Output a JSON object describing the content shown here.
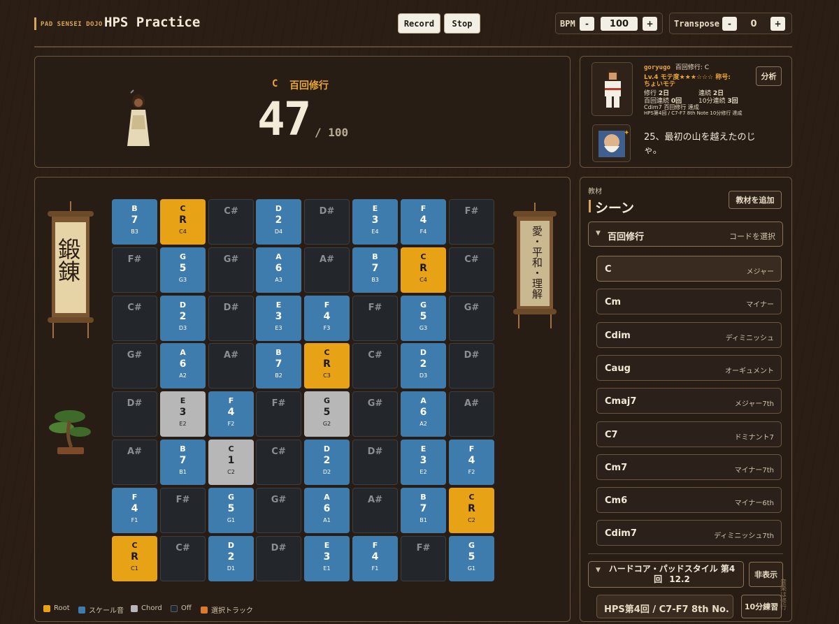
{
  "header": {
    "brand_small": "PAD SENSEI DOJO",
    "title": "HPS Practice",
    "record_label": "Record",
    "stop_label": "Stop",
    "bpm_label": "BPM",
    "bpm_minus": "-",
    "bpm_value": "100",
    "bpm_plus": "+",
    "transpose_label": "Transpose",
    "transpose_minus": "-",
    "transpose_value": "0",
    "transpose_plus": "+"
  },
  "status": {
    "chord": "C",
    "mode": "百回修行",
    "count": "47",
    "total": "/ 100"
  },
  "profile": {
    "username": "goryugo",
    "mode_text": "百回修行: C",
    "level_text": "Lv.4 モテ度★★★☆☆☆ 称号:",
    "title_text": "ちょいモテ",
    "stat_days_label": "修行",
    "stat_days_value": "2日",
    "stat_streak_label": "連続",
    "stat_streak_value": "2日",
    "stat_consec_label": "百回連続",
    "stat_consec_value": "0回",
    "stat_tenmin_label": "10分連続",
    "stat_tenmin_value": "3回",
    "line_cdim": "Cdim7 百回修行 達成",
    "line_hps": "HPS第4回 / C7-F7 8th Note 10分修行 達成",
    "analyze_label": "分析",
    "sensei_message": "25、最初の山を越えたのじゃ。"
  },
  "scrolls": {
    "left_text": "鍛錬",
    "right_text": "愛・平和・理解"
  },
  "pads": {
    "rows": [
      [
        [
          "B",
          "7",
          "B3",
          "scale"
        ],
        [
          "C",
          "R",
          "C4",
          "root"
        ],
        [
          "C#",
          "",
          "",
          "off"
        ],
        [
          "D",
          "2",
          "D4",
          "scale"
        ],
        [
          "D#",
          "",
          "",
          "off"
        ],
        [
          "E",
          "3",
          "E4",
          "scale"
        ],
        [
          "F",
          "4",
          "F4",
          "scale"
        ],
        [
          "F#",
          "",
          "",
          "off"
        ]
      ],
      [
        [
          "F#",
          "",
          "",
          "off"
        ],
        [
          "G",
          "5",
          "G3",
          "scale"
        ],
        [
          "G#",
          "",
          "",
          "off"
        ],
        [
          "A",
          "6",
          "A3",
          "scale"
        ],
        [
          "A#",
          "",
          "",
          "off"
        ],
        [
          "B",
          "7",
          "B3",
          "scale"
        ],
        [
          "C",
          "R",
          "C4",
          "root"
        ],
        [
          "C#",
          "",
          "",
          "off"
        ]
      ],
      [
        [
          "C#",
          "",
          "",
          "off"
        ],
        [
          "D",
          "2",
          "D3",
          "scale"
        ],
        [
          "D#",
          "",
          "",
          "off"
        ],
        [
          "E",
          "3",
          "E3",
          "scale"
        ],
        [
          "F",
          "4",
          "F3",
          "scale"
        ],
        [
          "F#",
          "",
          "",
          "off"
        ],
        [
          "G",
          "5",
          "G3",
          "scale"
        ],
        [
          "G#",
          "",
          "",
          "off"
        ]
      ],
      [
        [
          "G#",
          "",
          "",
          "off"
        ],
        [
          "A",
          "6",
          "A2",
          "scale"
        ],
        [
          "A#",
          "",
          "",
          "off"
        ],
        [
          "B",
          "7",
          "B2",
          "scale"
        ],
        [
          "C",
          "R",
          "C3",
          "root"
        ],
        [
          "C#",
          "",
          "",
          "off"
        ],
        [
          "D",
          "2",
          "D3",
          "scale"
        ],
        [
          "D#",
          "",
          "",
          "off"
        ]
      ],
      [
        [
          "D#",
          "",
          "",
          "off"
        ],
        [
          "E",
          "3",
          "E2",
          "chord"
        ],
        [
          "F",
          "4",
          "F2",
          "scale"
        ],
        [
          "F#",
          "",
          "",
          "off"
        ],
        [
          "G",
          "5",
          "G2",
          "chord"
        ],
        [
          "G#",
          "",
          "",
          "off"
        ],
        [
          "A",
          "6",
          "A2",
          "scale"
        ],
        [
          "A#",
          "",
          "",
          "off"
        ]
      ],
      [
        [
          "A#",
          "",
          "",
          "off"
        ],
        [
          "B",
          "7",
          "B1",
          "scale"
        ],
        [
          "C",
          "1",
          "C2",
          "chord"
        ],
        [
          "C#",
          "",
          "",
          "off"
        ],
        [
          "D",
          "2",
          "D2",
          "scale"
        ],
        [
          "D#",
          "",
          "",
          "off"
        ],
        [
          "E",
          "3",
          "E2",
          "scale"
        ],
        [
          "F",
          "4",
          "F2",
          "scale"
        ]
      ],
      [
        [
          "F",
          "4",
          "F1",
          "scale"
        ],
        [
          "F#",
          "",
          "",
          "off"
        ],
        [
          "G",
          "5",
          "G1",
          "scale"
        ],
        [
          "G#",
          "",
          "",
          "off"
        ],
        [
          "A",
          "6",
          "A1",
          "scale"
        ],
        [
          "A#",
          "",
          "",
          "off"
        ],
        [
          "B",
          "7",
          "B1",
          "scale"
        ],
        [
          "C",
          "R",
          "C2",
          "root"
        ]
      ],
      [
        [
          "C",
          "R",
          "C1",
          "root"
        ],
        [
          "C#",
          "",
          "",
          "off"
        ],
        [
          "D",
          "2",
          "D1",
          "scale"
        ],
        [
          "D#",
          "",
          "",
          "off"
        ],
        [
          "E",
          "3",
          "E1",
          "scale"
        ],
        [
          "F",
          "4",
          "F1",
          "scale"
        ],
        [
          "F#",
          "",
          "",
          "off"
        ],
        [
          "G",
          "5",
          "G1",
          "scale"
        ]
      ]
    ]
  },
  "legend": {
    "root": "Root",
    "scale": "スケール音",
    "chord": "Chord",
    "off": "Off",
    "track": "選択トラック"
  },
  "colors": {
    "root": "#e7a315",
    "scale": "#3f7cae",
    "chord": "#b7b7b7",
    "off": "#23272b",
    "track": "#d97a2e"
  },
  "right_panel": {
    "small_label": "教材",
    "title": "シーン",
    "add_label": "教材を追加",
    "section_title": "百回修行",
    "section_action": "コードを選択",
    "chords": [
      {
        "name": "C",
        "desc": "メジャー"
      },
      {
        "name": "Cm",
        "desc": "マイナー"
      },
      {
        "name": "Cdim",
        "desc": "ディミニッシュ"
      },
      {
        "name": "Caug",
        "desc": "オーギュメント"
      },
      {
        "name": "Cmaj7",
        "desc": "メジャー7th"
      },
      {
        "name": "C7",
        "desc": "ドミナント7"
      },
      {
        "name": "Cm7",
        "desc": "マイナー7th"
      },
      {
        "name": "Cm6",
        "desc": "マイナー6th"
      },
      {
        "name": "Cdim7",
        "desc": "ディミニッシュ7th"
      }
    ],
    "section2_title": "ハードコア・パッドスタイル 第4回",
    "section2_version": "12.2",
    "hide_label": "非表示",
    "track_name": "HPS第4回 / C7-F7 8th No...",
    "practice_label": "10分練習",
    "side_label": "音楽は修行"
  }
}
